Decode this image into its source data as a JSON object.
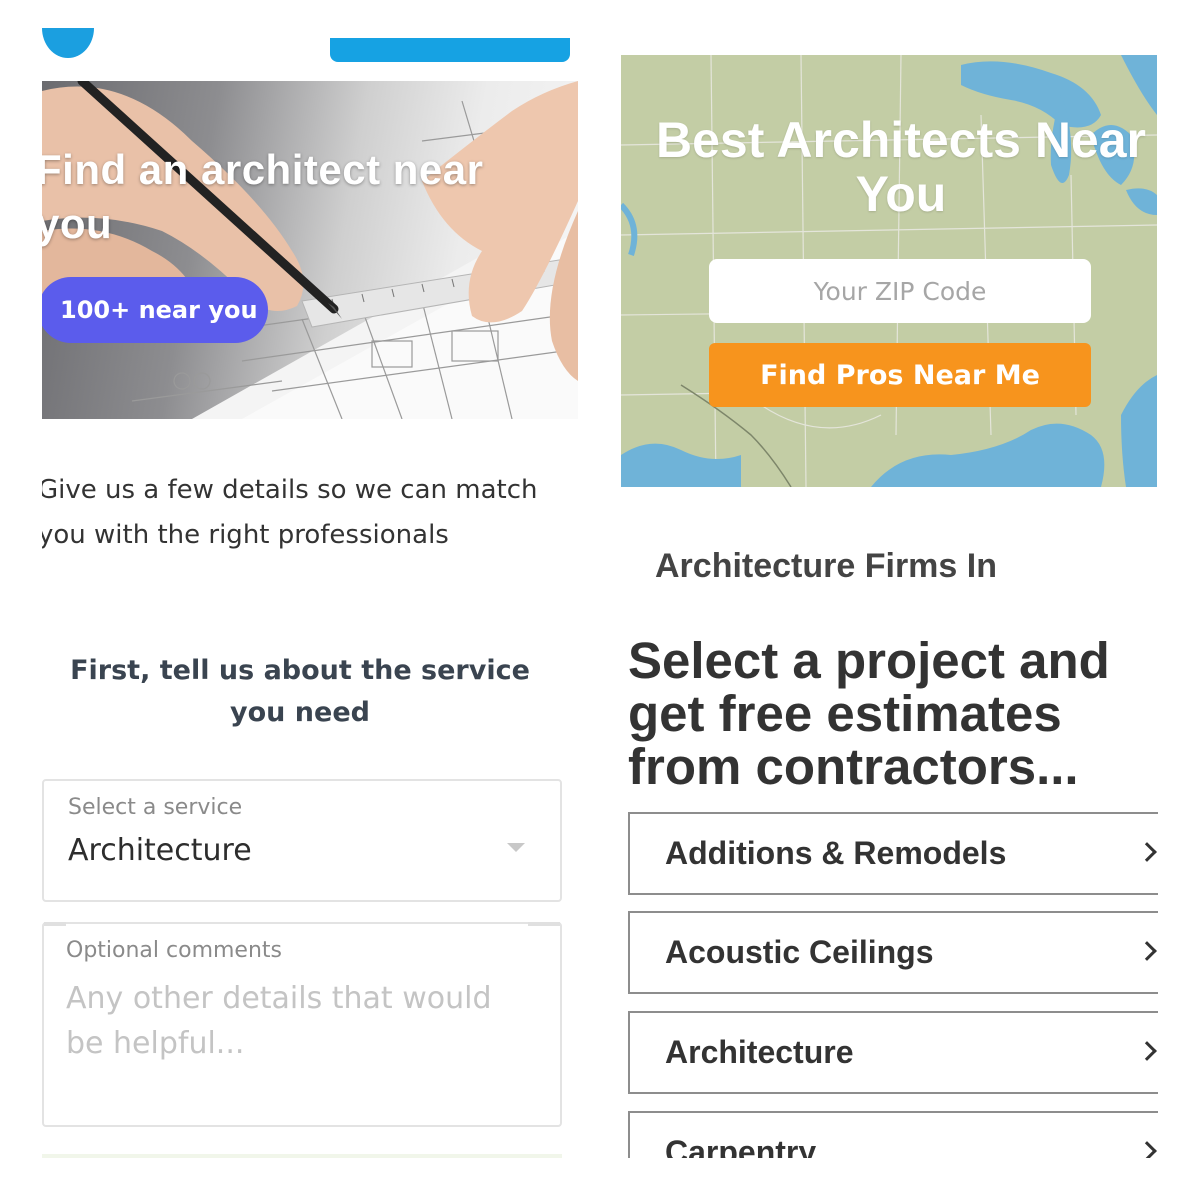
{
  "top_left": {
    "hero_title": "Find an architect near you",
    "near_button": "100+ near you",
    "intro_text": "Give us a few details so we can match you with the right professionals"
  },
  "top_right": {
    "map_title": "Best Architects Near You",
    "zip_placeholder": "Your ZIP Code",
    "find_button": "Find Pros Near Me",
    "firms_heading": "Architecture Firms In"
  },
  "bottom_left": {
    "heading": "First, tell us about the service you need",
    "service_label": "Select a service",
    "service_value": "Architecture",
    "comments_label": "Optional comments",
    "comments_placeholder": "Any other details that would be helpful..."
  },
  "bottom_right": {
    "heading": "Select a project and get free estimates from contractors...",
    "projects": [
      {
        "label": "Additions & Remodels"
      },
      {
        "label": "Acoustic Ceilings"
      },
      {
        "label": "Architecture"
      },
      {
        "label": "Carpentry"
      }
    ]
  },
  "colors": {
    "blue_accent": "#16a2e3",
    "near_button": "#5b5cec",
    "find_button": "#f7941d",
    "map_land": "#c3cda5",
    "map_water": "#6fb3d8"
  }
}
